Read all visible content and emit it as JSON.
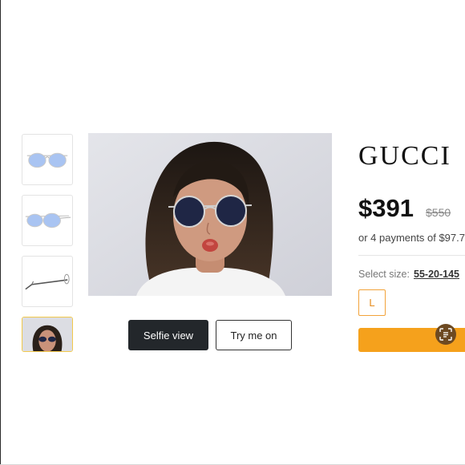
{
  "gallery": {
    "thumbnails": [
      {
        "icon": "sunglasses-front-icon",
        "lens_color": "#a9c4f2"
      },
      {
        "icon": "sunglasses-angle-icon",
        "lens_color": "#a9c4f2"
      },
      {
        "icon": "sunglasses-side-icon"
      },
      {
        "icon": "model-photo-icon",
        "selected": true
      }
    ],
    "main_image": {
      "subject": "model-wearing-sunglasses",
      "lens_color": "#1f2645"
    }
  },
  "actions": {
    "selfie_label": "Selfie view",
    "try_on_label": "Try me on"
  },
  "product": {
    "brand": "GUCCI",
    "price": "$391",
    "original_price": "$550",
    "payments_text": "or 4 payments of $97.7",
    "size_label": "Select size:",
    "size_value": "55-20-145",
    "size_option": "L"
  },
  "colors": {
    "accent": "#f5a11c",
    "primary_button": "#23272b"
  },
  "overlay": {
    "icon": "scan-text-icon"
  }
}
